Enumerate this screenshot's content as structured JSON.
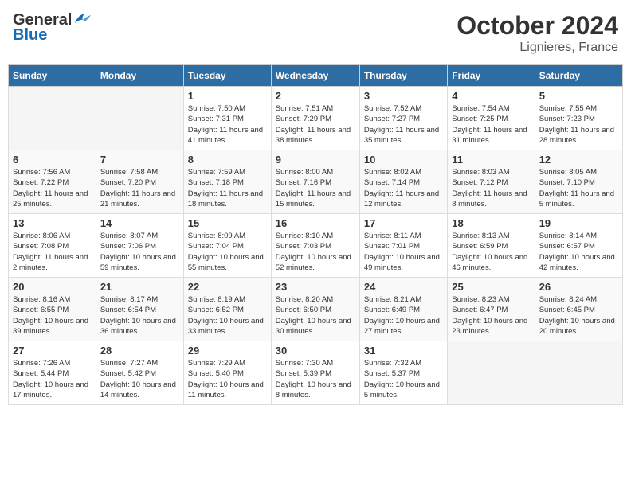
{
  "logo": {
    "general": "General",
    "blue": "Blue"
  },
  "header": {
    "month": "October 2024",
    "location": "Lignieres, France"
  },
  "weekdays": [
    "Sunday",
    "Monday",
    "Tuesday",
    "Wednesday",
    "Thursday",
    "Friday",
    "Saturday"
  ],
  "weeks": [
    [
      {
        "day": "",
        "info": ""
      },
      {
        "day": "",
        "info": ""
      },
      {
        "day": "1",
        "info": "Sunrise: 7:50 AM\nSunset: 7:31 PM\nDaylight: 11 hours and 41 minutes."
      },
      {
        "day": "2",
        "info": "Sunrise: 7:51 AM\nSunset: 7:29 PM\nDaylight: 11 hours and 38 minutes."
      },
      {
        "day": "3",
        "info": "Sunrise: 7:52 AM\nSunset: 7:27 PM\nDaylight: 11 hours and 35 minutes."
      },
      {
        "day": "4",
        "info": "Sunrise: 7:54 AM\nSunset: 7:25 PM\nDaylight: 11 hours and 31 minutes."
      },
      {
        "day": "5",
        "info": "Sunrise: 7:55 AM\nSunset: 7:23 PM\nDaylight: 11 hours and 28 minutes."
      }
    ],
    [
      {
        "day": "6",
        "info": "Sunrise: 7:56 AM\nSunset: 7:22 PM\nDaylight: 11 hours and 25 minutes."
      },
      {
        "day": "7",
        "info": "Sunrise: 7:58 AM\nSunset: 7:20 PM\nDaylight: 11 hours and 21 minutes."
      },
      {
        "day": "8",
        "info": "Sunrise: 7:59 AM\nSunset: 7:18 PM\nDaylight: 11 hours and 18 minutes."
      },
      {
        "day": "9",
        "info": "Sunrise: 8:00 AM\nSunset: 7:16 PM\nDaylight: 11 hours and 15 minutes."
      },
      {
        "day": "10",
        "info": "Sunrise: 8:02 AM\nSunset: 7:14 PM\nDaylight: 11 hours and 12 minutes."
      },
      {
        "day": "11",
        "info": "Sunrise: 8:03 AM\nSunset: 7:12 PM\nDaylight: 11 hours and 8 minutes."
      },
      {
        "day": "12",
        "info": "Sunrise: 8:05 AM\nSunset: 7:10 PM\nDaylight: 11 hours and 5 minutes."
      }
    ],
    [
      {
        "day": "13",
        "info": "Sunrise: 8:06 AM\nSunset: 7:08 PM\nDaylight: 11 hours and 2 minutes."
      },
      {
        "day": "14",
        "info": "Sunrise: 8:07 AM\nSunset: 7:06 PM\nDaylight: 10 hours and 59 minutes."
      },
      {
        "day": "15",
        "info": "Sunrise: 8:09 AM\nSunset: 7:04 PM\nDaylight: 10 hours and 55 minutes."
      },
      {
        "day": "16",
        "info": "Sunrise: 8:10 AM\nSunset: 7:03 PM\nDaylight: 10 hours and 52 minutes."
      },
      {
        "day": "17",
        "info": "Sunrise: 8:11 AM\nSunset: 7:01 PM\nDaylight: 10 hours and 49 minutes."
      },
      {
        "day": "18",
        "info": "Sunrise: 8:13 AM\nSunset: 6:59 PM\nDaylight: 10 hours and 46 minutes."
      },
      {
        "day": "19",
        "info": "Sunrise: 8:14 AM\nSunset: 6:57 PM\nDaylight: 10 hours and 42 minutes."
      }
    ],
    [
      {
        "day": "20",
        "info": "Sunrise: 8:16 AM\nSunset: 6:55 PM\nDaylight: 10 hours and 39 minutes."
      },
      {
        "day": "21",
        "info": "Sunrise: 8:17 AM\nSunset: 6:54 PM\nDaylight: 10 hours and 36 minutes."
      },
      {
        "day": "22",
        "info": "Sunrise: 8:19 AM\nSunset: 6:52 PM\nDaylight: 10 hours and 33 minutes."
      },
      {
        "day": "23",
        "info": "Sunrise: 8:20 AM\nSunset: 6:50 PM\nDaylight: 10 hours and 30 minutes."
      },
      {
        "day": "24",
        "info": "Sunrise: 8:21 AM\nSunset: 6:49 PM\nDaylight: 10 hours and 27 minutes."
      },
      {
        "day": "25",
        "info": "Sunrise: 8:23 AM\nSunset: 6:47 PM\nDaylight: 10 hours and 23 minutes."
      },
      {
        "day": "26",
        "info": "Sunrise: 8:24 AM\nSunset: 6:45 PM\nDaylight: 10 hours and 20 minutes."
      }
    ],
    [
      {
        "day": "27",
        "info": "Sunrise: 7:26 AM\nSunset: 5:44 PM\nDaylight: 10 hours and 17 minutes."
      },
      {
        "day": "28",
        "info": "Sunrise: 7:27 AM\nSunset: 5:42 PM\nDaylight: 10 hours and 14 minutes."
      },
      {
        "day": "29",
        "info": "Sunrise: 7:29 AM\nSunset: 5:40 PM\nDaylight: 10 hours and 11 minutes."
      },
      {
        "day": "30",
        "info": "Sunrise: 7:30 AM\nSunset: 5:39 PM\nDaylight: 10 hours and 8 minutes."
      },
      {
        "day": "31",
        "info": "Sunrise: 7:32 AM\nSunset: 5:37 PM\nDaylight: 10 hours and 5 minutes."
      },
      {
        "day": "",
        "info": ""
      },
      {
        "day": "",
        "info": ""
      }
    ]
  ]
}
